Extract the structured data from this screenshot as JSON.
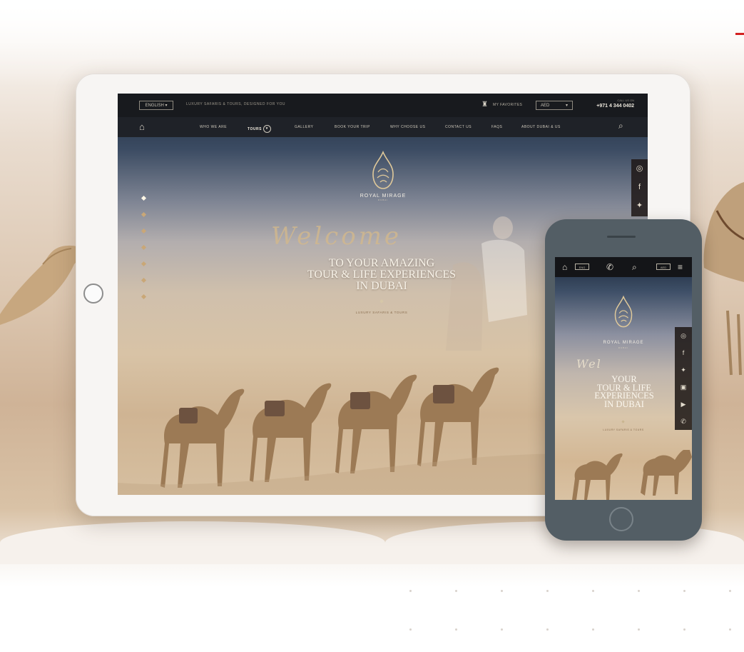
{
  "tablet": {
    "topbar": {
      "language": "ENGLISH ▾",
      "tagline": "LUXURY SAFARIS & TOURS, DESIGNED FOR YOU",
      "favourites": "MY FAVORITES",
      "currency": "AED",
      "call_label": "CALL US ON",
      "phone": "+971 4 344 0402"
    },
    "nav": {
      "items": [
        {
          "label": "WHO WE ARE"
        },
        {
          "label": "TOURS"
        },
        {
          "label": "GALLERY"
        },
        {
          "label": "BOOK YOUR TRIP"
        },
        {
          "label": "WHY CHOOSE US"
        },
        {
          "label": "CONTACT US"
        },
        {
          "label": "FAQS"
        },
        {
          "label": "ABOUT DUBAI & US"
        }
      ]
    },
    "brand": {
      "name": "ROYAL MIRAGE",
      "sub": "DUBAI"
    },
    "hero": {
      "welcome": "Welcome",
      "headline_1": "TO YOUR AMAZING",
      "headline_2": "TOUR & LIFE EXPERIENCES",
      "headline_3": "IN DUBAI",
      "subline": "LUXURY SAFARIS & TOURS"
    },
    "slider_count": 7,
    "slider_active": 1,
    "social": [
      "tripadvisor-icon",
      "facebook-icon",
      "twitter-icon"
    ]
  },
  "phone": {
    "topbar": {
      "lang": "ENG",
      "currency": "AED"
    },
    "brand": {
      "name": "ROYAL MIRAGE",
      "sub": "DUBAI"
    },
    "hero": {
      "welcome": "Wel",
      "headline_1": "YOUR",
      "headline_2": "TOUR & LIFE",
      "headline_3": "EXPERIENCES",
      "headline_4": "IN DUBAI",
      "subline": "LUXURY SAFARIS & TOURS"
    },
    "social": [
      "tripadvisor-icon",
      "facebook-icon",
      "twitter-icon",
      "instagram-icon",
      "youtube-icon",
      "whatsapp-icon"
    ]
  },
  "colors": {
    "accent": "#c9a777",
    "dark": "#181a1e",
    "sand": "#d6bfa0",
    "red": "#d32020"
  }
}
